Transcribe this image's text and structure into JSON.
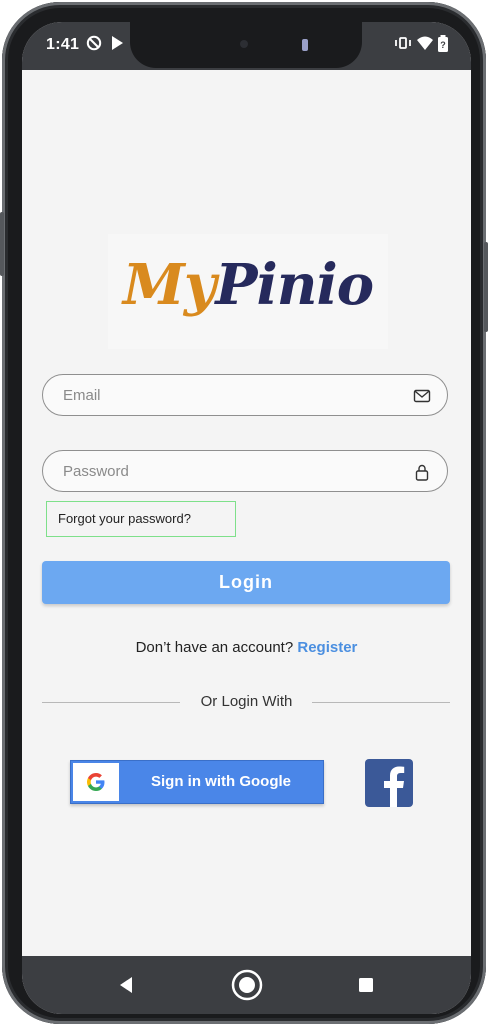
{
  "status_bar": {
    "time": "1:41"
  },
  "logo": {
    "part1": "My",
    "part2": "Pinio",
    "colors": {
      "my": "#d98a1e",
      "pinio": "#262a5c"
    }
  },
  "form": {
    "email": {
      "placeholder": "Email",
      "value": "",
      "icon": "mail-icon"
    },
    "password": {
      "placeholder": "Password",
      "value": "",
      "icon": "lock-icon"
    },
    "forgot_label": "Forgot your password?",
    "login_label": "Login"
  },
  "register": {
    "prompt": "Don’t have an account?",
    "link_label": "Register"
  },
  "social": {
    "divider_label": "Or Login With",
    "google_label": "Sign in with Google",
    "facebook_icon": "facebook-icon"
  },
  "colors": {
    "accent": "#6ca8f1",
    "link": "#4b8fe0",
    "google_blue": "#4a86e8",
    "facebook_blue": "#3b5998",
    "screen_bg": "#f4f4f4"
  }
}
